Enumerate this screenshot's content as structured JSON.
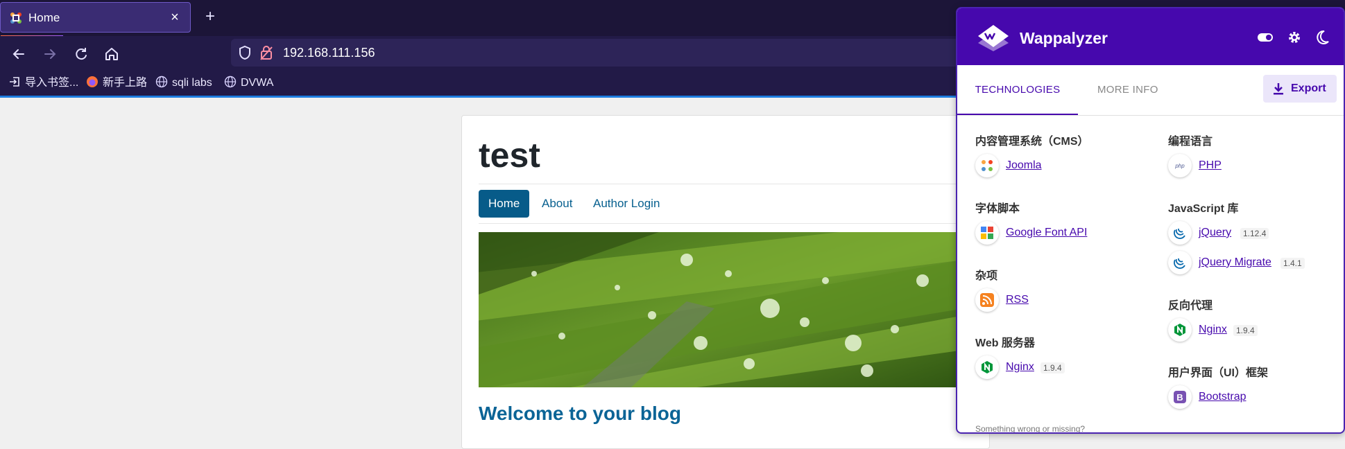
{
  "browser": {
    "tab_title": "Home",
    "tab_close": "×",
    "new_tab": "+",
    "url": "192.168.111.156",
    "bookmarks": [
      {
        "label": "导入书签..."
      },
      {
        "label": "新手上路"
      },
      {
        "label": "sqli labs"
      },
      {
        "label": "DVWA"
      }
    ]
  },
  "site": {
    "title": "test",
    "menu": [
      "Home",
      "About",
      "Author Login"
    ],
    "welcome": "Welcome to your blog"
  },
  "wappalyzer": {
    "brand": "Wappalyzer",
    "tabs": [
      "TECHNOLOGIES",
      "MORE INFO"
    ],
    "export_label": "Export",
    "left_categories": [
      {
        "name": "内容管理系统（CMS）",
        "techs": [
          {
            "name": "Joomla",
            "version": "",
            "icon": "joomla-icon"
          }
        ]
      },
      {
        "name": "字体脚本",
        "techs": [
          {
            "name": "Google Font API",
            "version": "",
            "icon": "google-font-api-icon"
          }
        ]
      },
      {
        "name": "杂项",
        "techs": [
          {
            "name": "RSS",
            "version": "",
            "icon": "rss-icon"
          }
        ]
      },
      {
        "name": "Web 服务器",
        "techs": [
          {
            "name": "Nginx",
            "version": "1.9.4",
            "icon": "nginx-icon"
          }
        ]
      }
    ],
    "right_categories": [
      {
        "name": "编程语言",
        "techs": [
          {
            "name": "PHP",
            "version": "",
            "icon": "php-icon"
          }
        ]
      },
      {
        "name": "JavaScript 库",
        "techs": [
          {
            "name": "jQuery",
            "version": "1.12.4",
            "icon": "jquery-icon"
          },
          {
            "name": "jQuery Migrate",
            "version": "1.4.1",
            "icon": "jquery-icon"
          }
        ]
      },
      {
        "name": "反向代理",
        "techs": [
          {
            "name": "Nginx",
            "version": "1.9.4",
            "icon": "nginx-icon"
          }
        ]
      },
      {
        "name": "用户界面（UI）框架",
        "techs": [
          {
            "name": "Bootstrap",
            "version": "",
            "icon": "bootstrap-icon"
          }
        ]
      }
    ],
    "footer_link": "Something wrong or missing?"
  },
  "colors": {
    "chrome_bg": "#221a47",
    "wappalyzer_purple": "#4608ad",
    "site_link": "#08608f"
  }
}
